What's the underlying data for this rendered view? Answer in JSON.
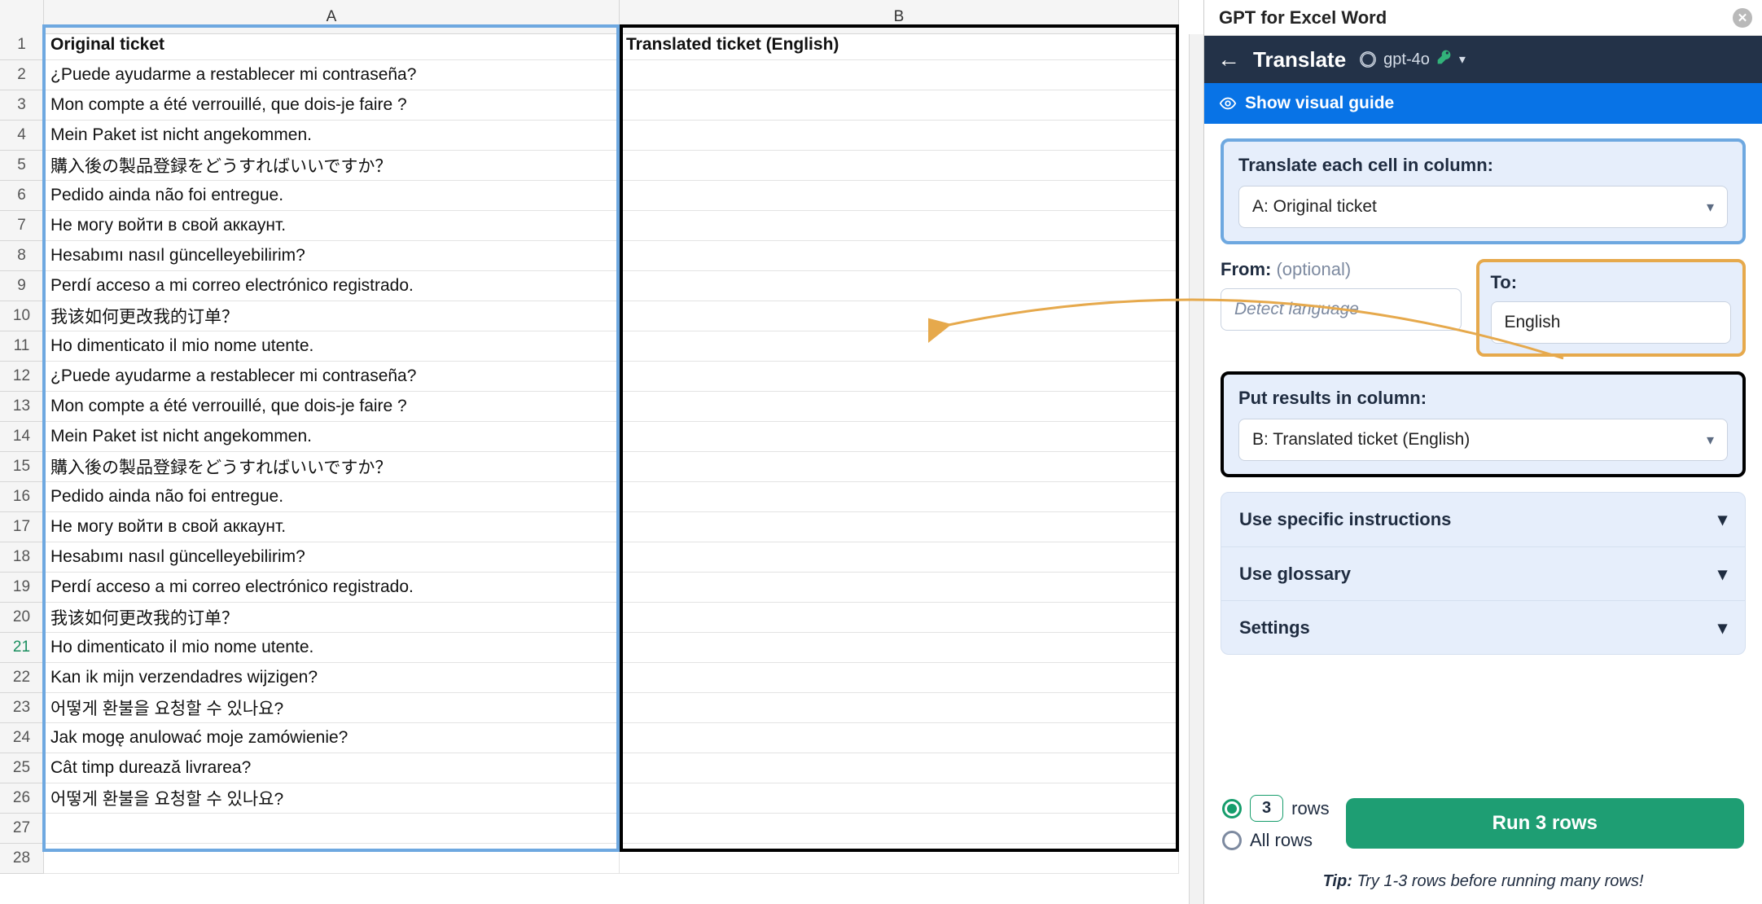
{
  "sheet": {
    "columns": [
      "A",
      "B"
    ],
    "header_row": {
      "A": "Original ticket",
      "B": "Translated ticket (English)"
    },
    "rows": [
      "¿Puede ayudarme a restablecer mi contraseña?",
      "Mon compte a été verrouillé, que dois-je faire ?",
      "Mein Paket ist nicht angekommen.",
      "購入後の製品登録をどうすればいいですか？",
      "Pedido ainda não foi entregue.",
      "Не могу войти в свой аккаунт.",
      "Hesabımı nasıl güncelleyebilirim?",
      "Perdí acceso a mi correo electrónico registrado.",
      "我该如何更改我的订单？",
      "Ho dimenticato il mio nome utente.",
      "¿Puede ayudarme a restablecer mi contraseña?",
      "Mon compte a été verrouillé, que dois-je faire ?",
      "Mein Paket ist nicht angekommen.",
      "購入後の製品登録をどうすればいいですか？",
      "Pedido ainda não foi entregue.",
      "Не могу войти в свой аккаунт.",
      "Hesabımı nasıl güncelleyebilirim?",
      "Perdí acceso a mi correo electrónico registrado.",
      "我该如何更改我的订单？",
      "Ho dimenticato il mio nome utente.",
      "Kan ik mijn verzendadres wijzigen?",
      "어떻게 환불을 요청할 수 있나요?",
      "Jak mogę anulować moje zamówienie?",
      "Cât timp durează livrarea?",
      "어떻게 환불을 요청할 수 있나요?"
    ],
    "selected_row": 21,
    "visible_row_count": 28
  },
  "panel": {
    "app_title": "GPT for Excel Word",
    "header_title": "Translate",
    "model_name": "gpt-4o",
    "guide_label": "Show visual guide",
    "source_section": {
      "label": "Translate each cell in column:",
      "value": "A: Original ticket"
    },
    "from": {
      "label": "From:",
      "optional": "(optional)",
      "placeholder": "Detect language"
    },
    "to": {
      "label": "To:",
      "value": "English"
    },
    "dest_section": {
      "label": "Put results in column:",
      "value": "B: Translated ticket (English)"
    },
    "accordion": [
      "Use specific instructions",
      "Use glossary",
      "Settings"
    ],
    "rows_count": "3",
    "rows_label": "rows",
    "all_rows_label": "All rows",
    "run_label": "Run 3 rows",
    "tip_bold": "Tip:",
    "tip_text": "Try 1-3 rows before running many rows!"
  }
}
